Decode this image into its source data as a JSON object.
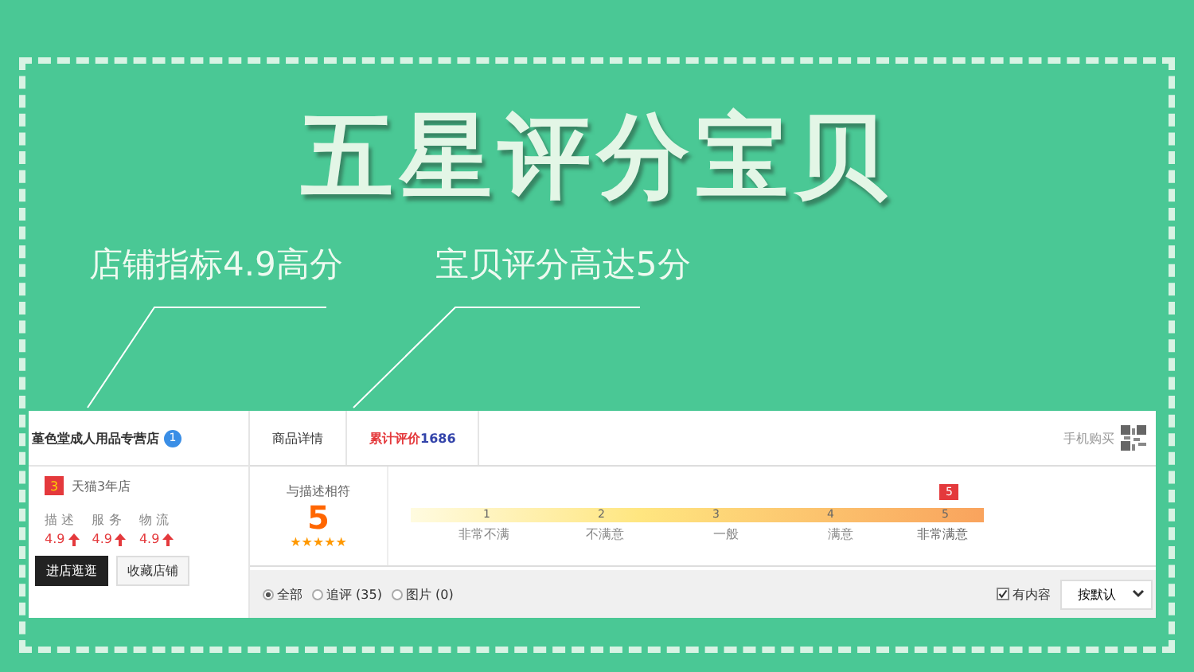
{
  "headline": "五星评分宝贝",
  "callouts": [
    "店铺指标4.9高分",
    "宝贝评分高达5分"
  ],
  "shop": {
    "name": "堇色堂成人用品专营店",
    "badge": "1",
    "rank": "3",
    "age": "天猫3年店",
    "metrics": [
      {
        "label": "描 述",
        "value": "4.9",
        "up": true
      },
      {
        "label": "服 务",
        "value": "4.9",
        "up": true
      },
      {
        "label": "物 流",
        "value": "4.9",
        "up": true
      }
    ],
    "buttons": [
      {
        "label": "进店逛逛",
        "primary": true
      },
      {
        "label": "收藏店铺",
        "primary": false
      }
    ]
  },
  "tabs": [
    {
      "label": "商品详情",
      "selected": false
    },
    {
      "label": "累计评价",
      "count": "1686",
      "selected": true
    }
  ],
  "mobile_buy": "手机购买",
  "score": {
    "label": "与描述相符",
    "value": "5",
    "stars": 5
  },
  "scale": {
    "marker": "5",
    "steps": [
      {
        "number": "1",
        "label": "非常不满",
        "selected": false
      },
      {
        "number": "2",
        "label": "不满意",
        "selected": false
      },
      {
        "number": "3",
        "label": "一般",
        "selected": false
      },
      {
        "number": "4",
        "label": "满意",
        "selected": false
      },
      {
        "number": "5",
        "label": "非常满意",
        "selected": true
      }
    ]
  },
  "filters": [
    {
      "label": "全部",
      "selected": true
    },
    {
      "label": "追评 (35)",
      "selected": false
    },
    {
      "label": "图片 (0)",
      "selected": false
    }
  ],
  "has_content": {
    "label": "有内容",
    "checked": true
  },
  "sort": {
    "value": "按默认"
  }
}
